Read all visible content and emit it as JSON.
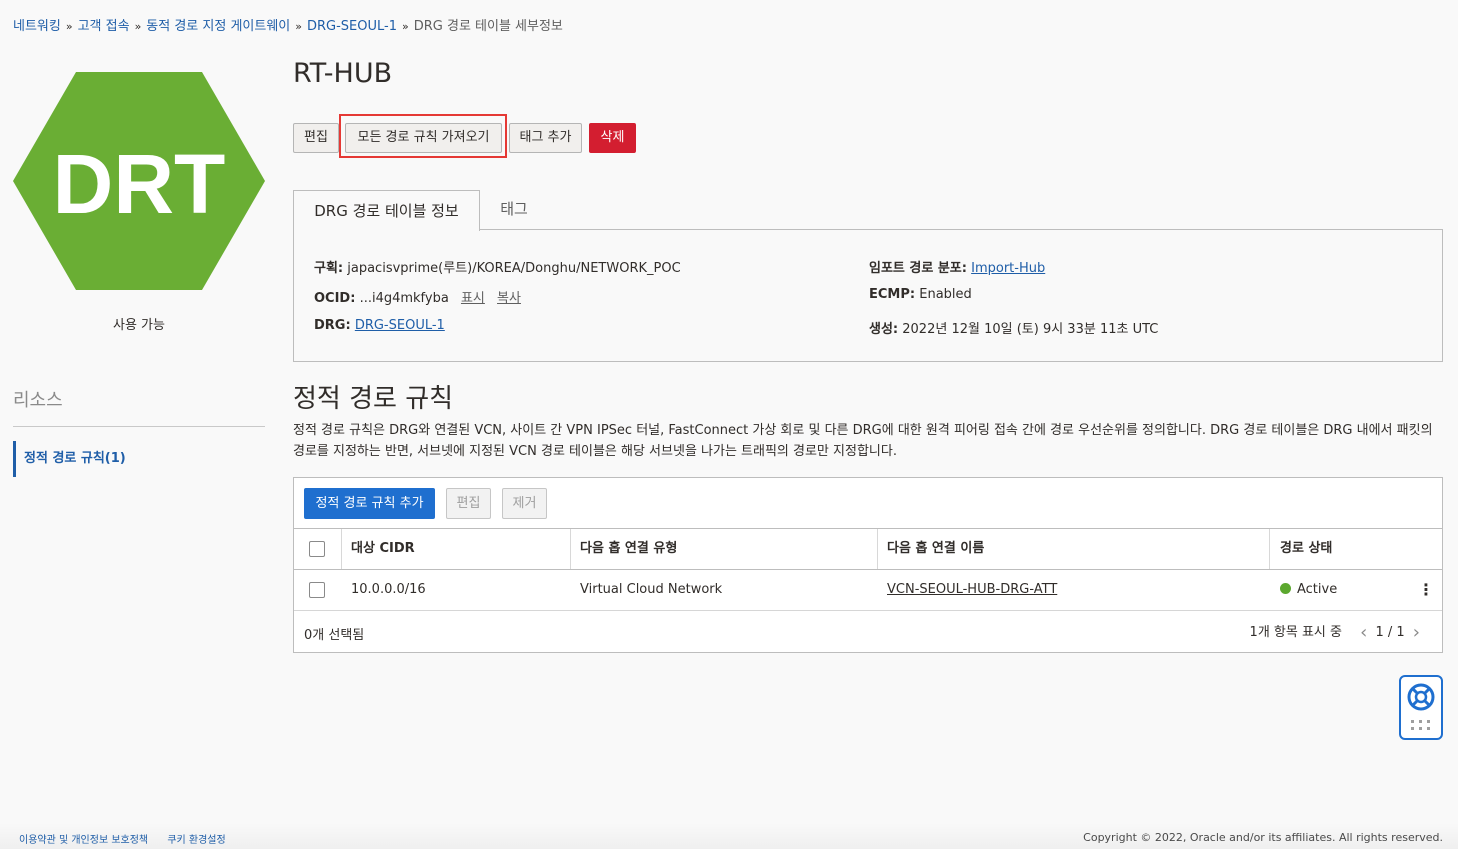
{
  "breadcrumb": {
    "items": [
      "네트워킹",
      "고객 접속",
      "동적 경로 지정 게이트웨이",
      "DRG-SEOUL-1"
    ],
    "current": "DRG 경로 테이블 세부정보",
    "separator": "»"
  },
  "left": {
    "icon_text": "DRT",
    "icon_color": "#6aae34",
    "status": "사용 가능",
    "resources_title": "리소스",
    "resources_item": "정적 경로 규칙(1)"
  },
  "header": {
    "title": "RT-HUB",
    "buttons": {
      "edit": "편집",
      "import_all": "모든 경로 규칙 가져오기",
      "add_tag": "태그 추가",
      "delete": "삭제"
    }
  },
  "tabs": [
    "DRG 경로 테이블 정보",
    "태그"
  ],
  "info": {
    "compartment_label": "구획:",
    "compartment_value": "japacisvprime(루트)/KOREA/Donghu/NETWORK_POC",
    "ocid_label": "OCID:",
    "ocid_value": "...i4g4mkfyba",
    "ocid_show": "표시",
    "ocid_copy": "복사",
    "drg_label": "DRG:",
    "drg_value": "DRG-SEOUL-1",
    "import_dist_label": "임포트 경로 분포:",
    "import_dist_value": "Import-Hub",
    "ecmp_label": "ECMP:",
    "ecmp_value": "Enabled",
    "created_label": "생성:",
    "created_value": "2022년 12월 10일 (토) 9시 33분 11초 UTC"
  },
  "section": {
    "title": "정적 경로 규칙",
    "description": "정적 경로 규칙은 DRG와 연결된 VCN, 사이트 간 VPN IPSec 터널, FastConnect 가상 회로 및 다른 DRG에 대한 원격 피어링 접속 간에 경로 우선순위를 정의합니다. DRG 경로 테이블은 DRG 내에서 패킷의 경로를 지정하는 반면, 서브넷에 지정된 VCN 경로 테이블은 해당 서브넷을 나가는 트래픽의 경로만 지정합니다."
  },
  "table": {
    "buttons": {
      "add": "정적 경로 규칙 추가",
      "edit": "편집",
      "remove": "제거"
    },
    "columns": [
      "대상 CIDR",
      "다음 홉 연결 유형",
      "다음 홉 연결 이름",
      "경로 상태"
    ],
    "rows": [
      {
        "cidr": "10.0.0.0/16",
        "type": "Virtual Cloud Network",
        "name": "VCN-SEOUL-HUB-DRG-ATT",
        "status": "Active",
        "status_color": "#5ca82f"
      }
    ],
    "selected": "0개 선택됨",
    "count_text": "1개 항목 표시 중",
    "page": "1 / 1"
  },
  "footer": {
    "terms": "이용약관 및 개인정보 보호정책",
    "cookies": "쿠키 환경설정",
    "copyright": "Copyright © 2022, Oracle and/or its affiliates. All rights reserved."
  },
  "colors": {
    "accent": "#1f6fcf",
    "danger": "#d31e30",
    "highlight": "#e53935"
  }
}
